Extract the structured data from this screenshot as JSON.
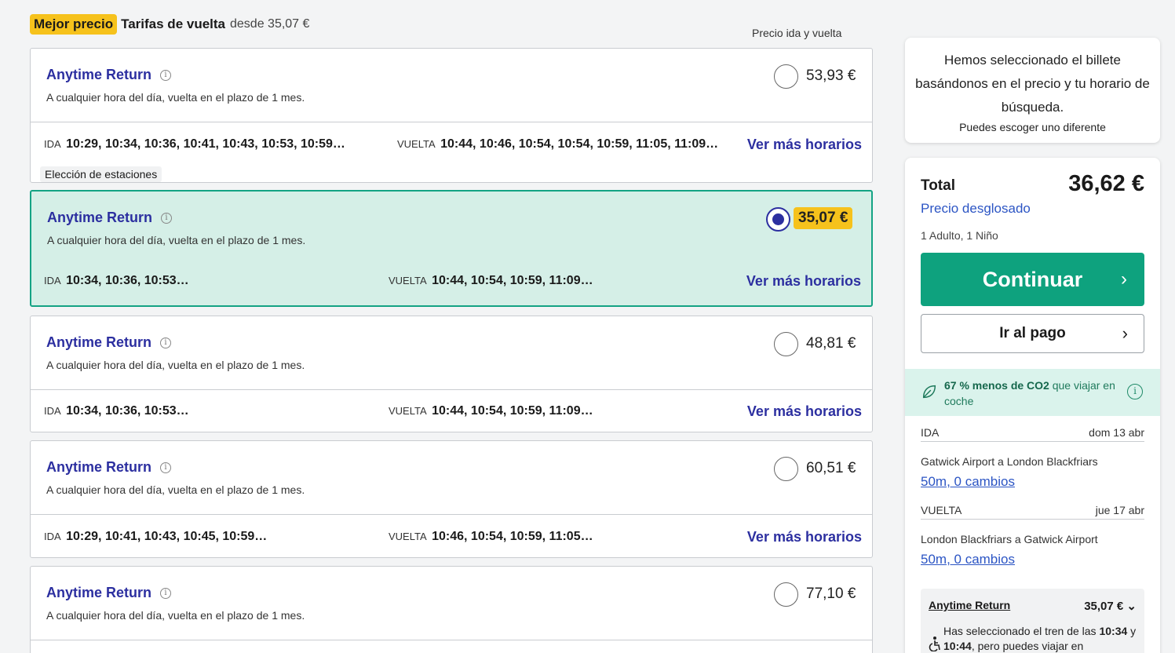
{
  "header": {
    "badge": "Mejor precio",
    "title": "Tarifas de vuelta",
    "from_text": "desde 35,07 €",
    "price_column_label": "Precio ida y vuelta"
  },
  "fares": [
    {
      "name": "Anytime Return",
      "description": "A cualquier hora del día, vuelta en el plazo de 1 mes.",
      "price": "53,93 €",
      "selected": false,
      "outbound_label": "IDA",
      "outbound_times": "10:29, 10:34, 10:36, 10:41, 10:43, 10:53, 10:59…",
      "return_label": "VUELTA",
      "return_times": "10:44, 10:46, 10:54, 10:54, 10:59, 11:05, 11:09…",
      "more_label": "Ver más horarios",
      "tag": "Elección de estaciones"
    },
    {
      "name": "Anytime Return",
      "description": "A cualquier hora del día, vuelta en el plazo de 1 mes.",
      "price": "35,07 €",
      "selected": true,
      "outbound_label": "IDA",
      "outbound_times": "10:34, 10:36, 10:53…",
      "return_label": "VUELTA",
      "return_times": "10:44, 10:54, 10:59, 11:09…",
      "more_label": "Ver más horarios"
    },
    {
      "name": "Anytime Return",
      "description": "A cualquier hora del día, vuelta en el plazo de 1 mes.",
      "price": "48,81 €",
      "selected": false,
      "outbound_label": "IDA",
      "outbound_times": "10:34, 10:36, 10:53…",
      "return_label": "VUELTA",
      "return_times": "10:44, 10:54, 10:59, 11:09…",
      "more_label": "Ver más horarios"
    },
    {
      "name": "Anytime Return",
      "description": "A cualquier hora del día, vuelta en el plazo de 1 mes.",
      "price": "60,51 €",
      "selected": false,
      "outbound_label": "IDA",
      "outbound_times": "10:29, 10:41, 10:43, 10:45, 10:59…",
      "return_label": "VUELTA",
      "return_times": "10:46, 10:54, 10:59, 11:05…",
      "more_label": "Ver más horarios"
    },
    {
      "name": "Anytime Return",
      "description": "A cualquier hora del día, vuelta en el plazo de 1 mes.",
      "price": "77,10 €",
      "selected": false
    }
  ],
  "note": {
    "main": "Hemos seleccionado el billete basándonos en el precio y tu horario de búsqueda.",
    "sub": "Puedes escoger uno diferente"
  },
  "summary": {
    "total_label": "Total",
    "total_value": "36,62 €",
    "breakdown_link": "Precio desglosado",
    "passengers": "1 Adulto, 1 Niño",
    "continue_button": "Continuar",
    "pay_button": "Ir al pago",
    "co2_bold": "67 % menos de CO2",
    "co2_rest": " que viajar en coche",
    "outbound": {
      "label": "IDA",
      "date": "dom 13 abr",
      "route": "Gatwick Airport a London Blackfriars",
      "duration": "50m, 0 cambios"
    },
    "return": {
      "label": "VUELTA",
      "date": "jue 17 abr",
      "route": "London Blackfriars a Gatwick Airport",
      "duration": "50m, 0 cambios"
    },
    "fare_name": "Anytime Return",
    "fare_price": "35,07 €",
    "msg_pre": "Has seleccionado el tren de las ",
    "msg_t1": "10:34",
    "msg_mid": " y ",
    "msg_t2": "10:44",
    "msg_post": ", pero puedes viajar en"
  },
  "colors": {
    "accent_blue": "#2c2fa0",
    "link_blue": "#2c55c4",
    "green": "#0ea27e",
    "highlight_yellow": "#f6c21c",
    "selected_bg": "#d5efe7"
  }
}
